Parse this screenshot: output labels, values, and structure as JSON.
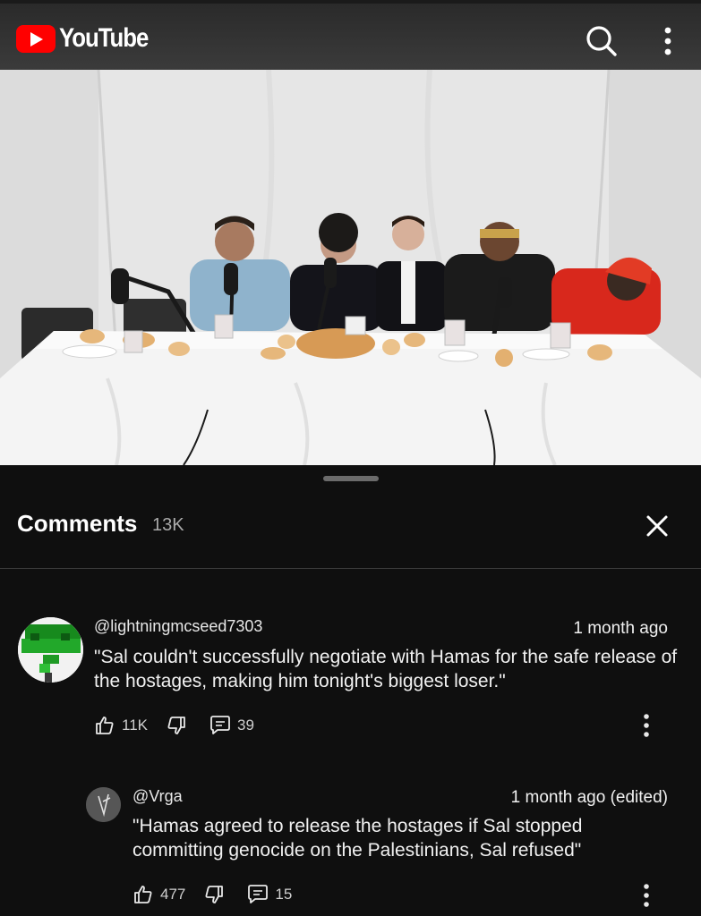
{
  "app": {
    "logo_text": "YouTube"
  },
  "header": {
    "search_icon": "search-icon",
    "more_icon": "more-vert-icon"
  },
  "colors": {
    "brand_red": "#ff0000",
    "background": "#0f0f0f",
    "text": "#f1f1f1",
    "muted": "#aaaaaa"
  },
  "comments_panel": {
    "title": "Comments",
    "count": "13K",
    "close_icon": "close-icon"
  },
  "comments": [
    {
      "author": "@lightningmcseed7303",
      "time": "1 month ago",
      "text": "\"Sal couldn't successfully negotiate with Hamas for the safe release of the hostages, making him tonight's biggest loser.\"",
      "likes": "11K",
      "replies": "39"
    },
    {
      "author": "@Vrga",
      "time": "1 month ago (edited)",
      "text": "\"Hamas agreed to release the hostages if Sal stopped committing genocide on the Palestinians, Sal refused\"",
      "likes": "477",
      "replies": "15"
    }
  ]
}
